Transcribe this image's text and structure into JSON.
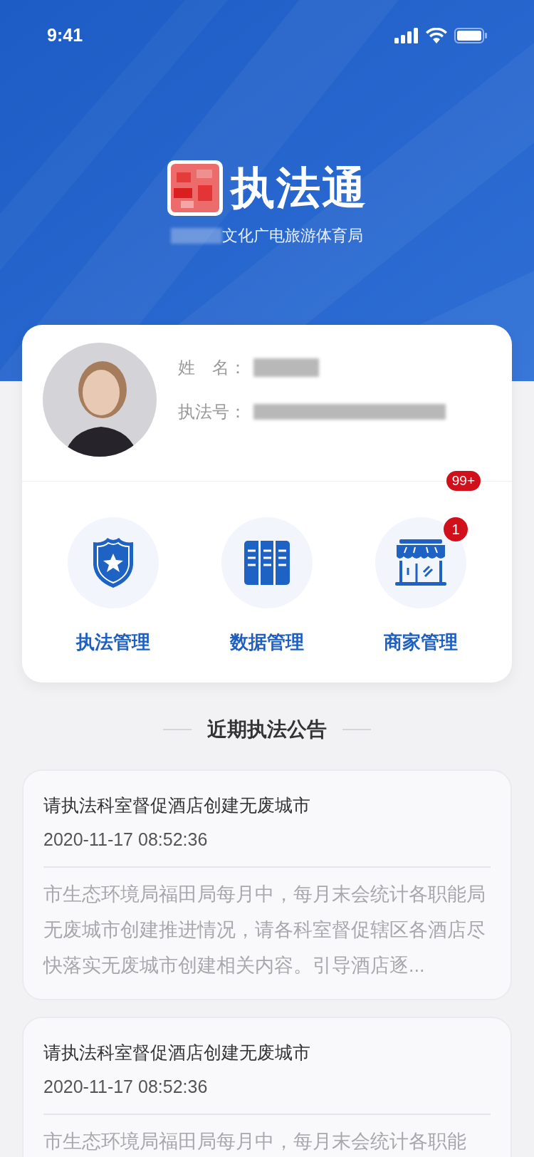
{
  "status_bar": {
    "time": "9:41"
  },
  "header": {
    "app_name": "执法通",
    "org_suffix": "文化广电旅游体育局"
  },
  "profile": {
    "name_label": "姓　名：",
    "id_label": "执法号："
  },
  "card_badge": "99+",
  "menu": [
    {
      "kind": "shield",
      "label": "执法管理"
    },
    {
      "kind": "cabinet",
      "label": "数据管理"
    },
    {
      "kind": "store",
      "label": "商家管理",
      "badge": "1"
    }
  ],
  "section_title": "近期执法公告",
  "notices": [
    {
      "title": "请执法科室督促酒店创建无废城市",
      "time": "2020-11-17 08:52:36",
      "body": "市生态环境局福田局每月中，每月末会统计各职能局无废城市创建推进情况，请各科室督促辖区各酒店尽快落实无废城市创建相关内容。引导酒店逐..."
    },
    {
      "title": "请执法科室督促酒店创建无废城市",
      "time": "2020-11-17 08:52:36",
      "body": "市生态环境局福田局每月中，每月末会统计各职能"
    }
  ]
}
